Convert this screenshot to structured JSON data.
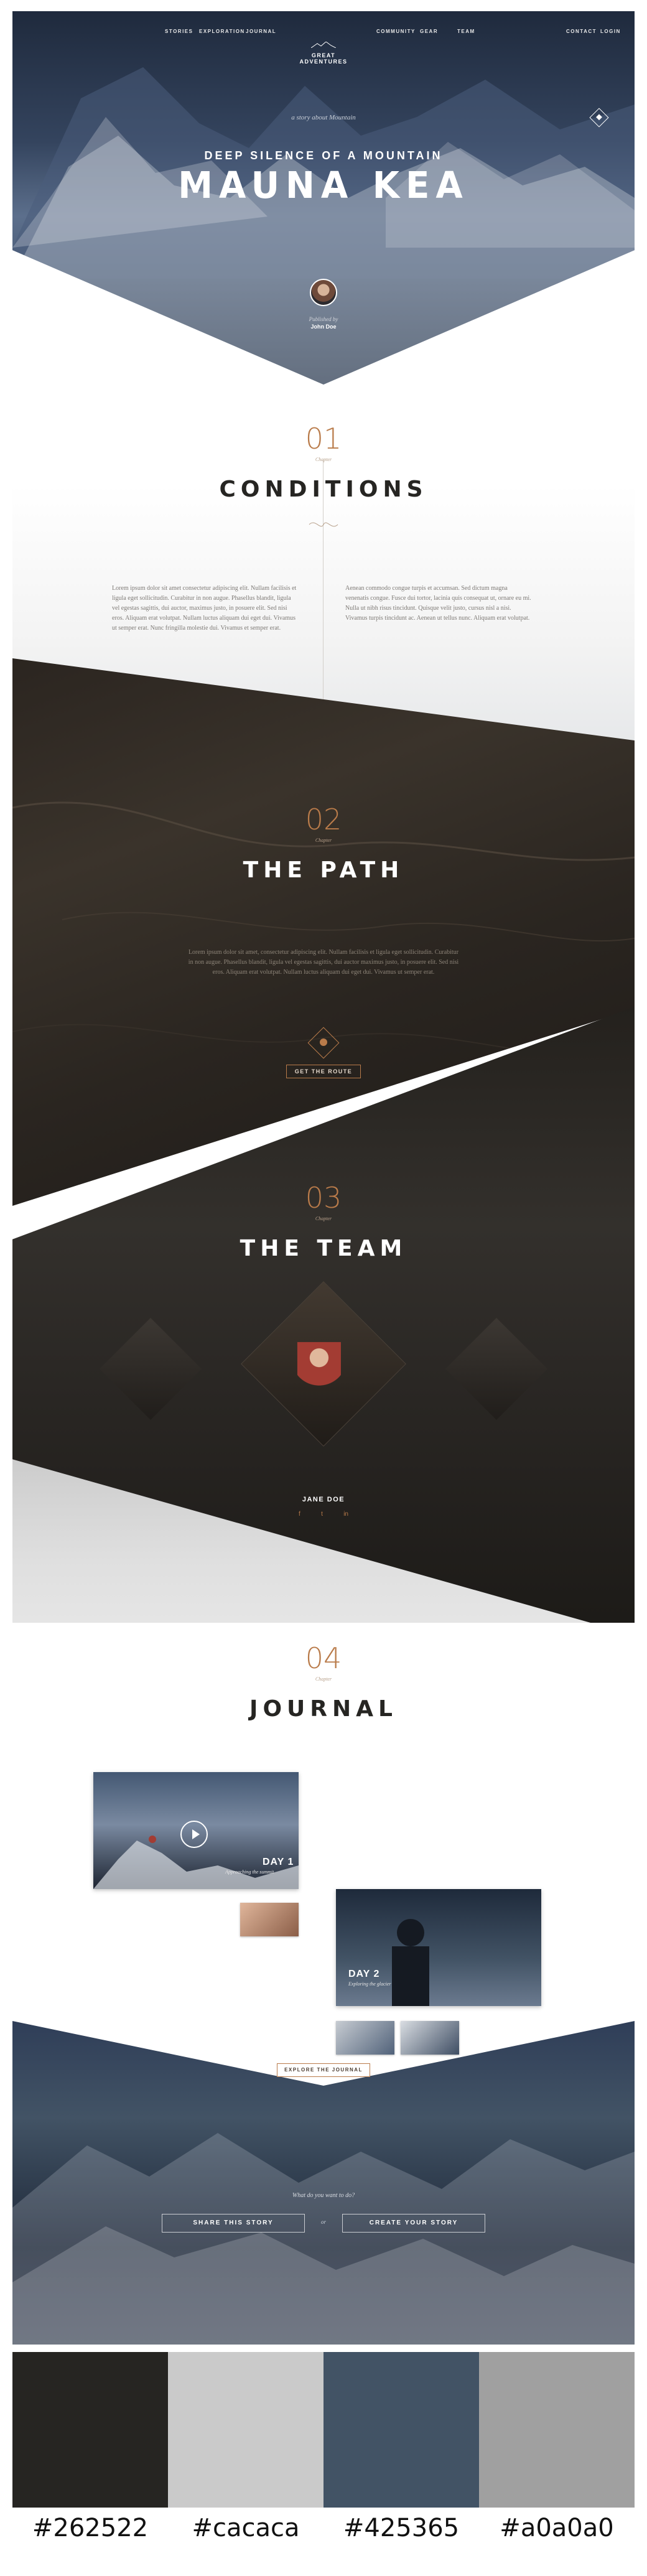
{
  "nav": {
    "left_items": [
      "STORIES",
      "EXPLORATION",
      "JOURNAL"
    ],
    "logo": "GREAT ADVENTURES",
    "right_items": [
      "COMMUNITY",
      "GEAR",
      "TEAM"
    ],
    "far_right": [
      "CONTACT",
      "LOGIN"
    ]
  },
  "hero": {
    "kicker": "a story about Mountain",
    "subtitle": "DEEP SILENCE OF A MOUNTAIN",
    "title": "MAUNA KEA",
    "author_label": "Published by",
    "author_name": "John Doe"
  },
  "conditions": {
    "number": "01",
    "caption": "Chapter",
    "title": "CONDITIONS",
    "col_left": "Lorem ipsum dolor sit amet consectetur adipiscing elit. Nullam facilisis et ligula eget sollicitudin. Curabitur in non augue. Phasellus blandit, ligula vel egestas sagittis, dui auctor, maximus justo, in posuere elit. Sed nisi eros. Aliquam erat volutpat. Nullam luctus aliquam dui eget dui. Vivamus ut semper erat. Nunc fringilla molestie dui. Vivamus et semper erat.",
    "col_right": "Aenean commodo congue turpis et accumsan. Sed dictum magna venenatis congue. Fusce dui tortor, lacinia quis consequat ut, ornare eu mi. Nulla ut nibh risus tincidunt. Quisque velit justo, cursus nisl a nisi. Vivamus turpis tincidunt ac. Aenean ut tellus nunc. Aliquam erat volutpat."
  },
  "path": {
    "number": "02",
    "caption": "Chapter",
    "title": "THE PATH",
    "text": "Lorem ipsum dolor sit amet, consectetur adipiscing elit. Nullam facilisis et ligula eget sollicitudin. Curabitur in non augue. Phasellus blandit, ligula vel egestas sagittis, dui auctor maximus justo, in posuere elit. Sed nisi eros. Aliquam erat volutpat. Nullam luctus aliquam dui eget dui. Vivamus ut semper erat.",
    "button": "GET THE ROUTE"
  },
  "team": {
    "number": "03",
    "caption": "Chapter",
    "title": "THE TEAM",
    "member_name": "JANE DOE",
    "socials": [
      "f",
      "t",
      "in"
    ]
  },
  "journal": {
    "number": "04",
    "caption": "Chapter",
    "title": "JOURNAL",
    "card1_day": "DAY 1",
    "card1_sub": "Approaching the summit",
    "card2_day": "DAY 2",
    "card2_sub": "Exploring the glacier",
    "button": "EXPLORE THE JOURNAL"
  },
  "footer": {
    "prompt": "What do you want to do?",
    "share": "SHARE THIS STORY",
    "or": "or",
    "create": "CREATE YOUR STORY"
  },
  "palette": [
    {
      "hex": "#262522",
      "label": "#262522"
    },
    {
      "hex": "#cacaca",
      "label": "#cacaca"
    },
    {
      "hex": "#425365",
      "label": "#425365"
    },
    {
      "hex": "#a0a0a0",
      "label": "#a0a0a0"
    }
  ],
  "colors": {
    "accent": "#b97b4a",
    "dark": "#262522",
    "slate": "#425365"
  }
}
